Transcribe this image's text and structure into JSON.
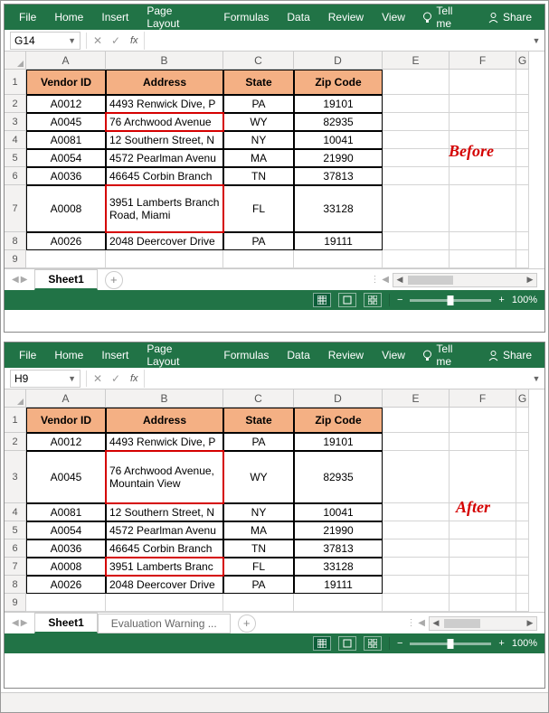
{
  "ribbon": {
    "tabs": [
      "File",
      "Home",
      "Insert",
      "Page Layout",
      "Formulas",
      "Data",
      "Review",
      "View"
    ],
    "tellme": "Tell me",
    "share": "Share"
  },
  "before": {
    "cellref": "G14",
    "annotation": "Before",
    "headers": [
      "Vendor ID",
      "Address",
      "State",
      "Zip Code"
    ],
    "rows": [
      {
        "id": "A0012",
        "addr": "4493 Renwick Dive, P",
        "state": "PA",
        "zip": "19101"
      },
      {
        "id": "A0045",
        "addr": "76 Archwood Avenue",
        "state": "WY",
        "zip": "82935"
      },
      {
        "id": "A0081",
        "addr": "12 Southern Street, N",
        "state": "NY",
        "zip": "10041"
      },
      {
        "id": "A0054",
        "addr": "4572 Pearlman Avenu",
        "state": "MA",
        "zip": "21990"
      },
      {
        "id": "A0036",
        "addr": "46645 Corbin Branch",
        "state": "TN",
        "zip": "37813"
      },
      {
        "id": "A0008",
        "addr": "3951 Lamberts Branch Road, Miami",
        "state": "FL",
        "zip": "33128"
      },
      {
        "id": "A0026",
        "addr": "2048 Deercover Drive",
        "state": "PA",
        "zip": "19111"
      }
    ],
    "cols": [
      "A",
      "B",
      "C",
      "D",
      "E",
      "F",
      "G"
    ],
    "rownums": [
      "1",
      "2",
      "3",
      "4",
      "5",
      "6",
      "7",
      "8",
      "9"
    ],
    "sheet": "Sheet1",
    "zoom": "100%"
  },
  "after": {
    "cellref": "H9",
    "annotation": "After",
    "headers": [
      "Vendor ID",
      "Address",
      "State",
      "Zip Code"
    ],
    "rows": [
      {
        "id": "A0012",
        "addr": "4493 Renwick Dive, P",
        "state": "PA",
        "zip": "19101"
      },
      {
        "id": "A0045",
        "addr": "76 Archwood Avenue, Mountain View",
        "state": "WY",
        "zip": "82935"
      },
      {
        "id": "A0081",
        "addr": "12 Southern Street, N",
        "state": "NY",
        "zip": "10041"
      },
      {
        "id": "A0054",
        "addr": "4572 Pearlman Avenu",
        "state": "MA",
        "zip": "21990"
      },
      {
        "id": "A0036",
        "addr": "46645 Corbin Branch",
        "state": "TN",
        "zip": "37813"
      },
      {
        "id": "A0008",
        "addr": "3951 Lamberts Branc",
        "state": "FL",
        "zip": "33128"
      },
      {
        "id": "A0026",
        "addr": "2048 Deercover Drive",
        "state": "PA",
        "zip": "19111"
      }
    ],
    "cols": [
      "A",
      "B",
      "C",
      "D",
      "E",
      "F",
      "G"
    ],
    "rownums": [
      "1",
      "2",
      "3",
      "4",
      "5",
      "6",
      "7",
      "8",
      "9"
    ],
    "sheets": [
      "Sheet1",
      "Evaluation Warning  ..."
    ],
    "zoom": "100%"
  }
}
